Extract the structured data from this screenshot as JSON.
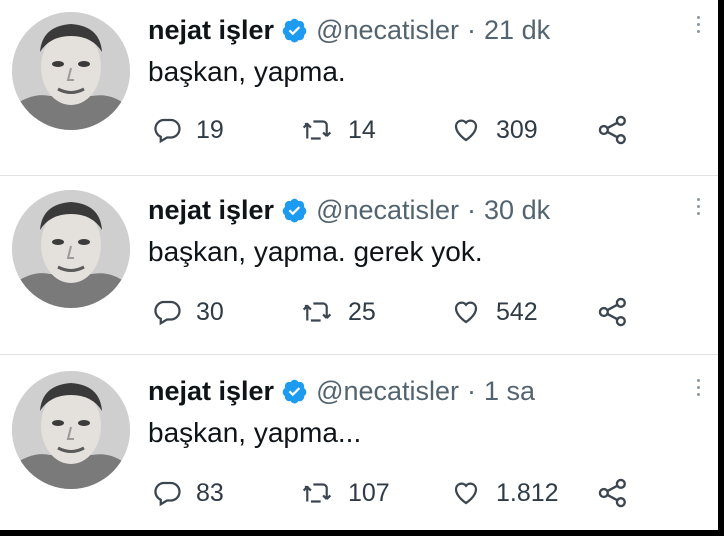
{
  "tweets": [
    {
      "author": "nejat işler",
      "handle": "@necatisler",
      "separator": "·",
      "time": "21 dk",
      "text": "başkan, yapma.",
      "replies": "19",
      "retweets": "14",
      "likes": "309"
    },
    {
      "author": "nejat işler",
      "handle": "@necatisler",
      "separator": "·",
      "time": "30 dk",
      "text": "başkan, yapma. gerek yok.",
      "replies": "30",
      "retweets": "25",
      "likes": "542"
    },
    {
      "author": "nejat işler",
      "handle": "@necatisler",
      "separator": "·",
      "time": "1 sa",
      "text": "başkan, yapma...",
      "replies": "83",
      "retweets": "107",
      "likes": "1.812"
    }
  ],
  "icons": {
    "reply": "reply-icon",
    "retweet": "retweet-icon",
    "like": "heart-icon",
    "share": "share-icon",
    "verified": "verified-badge-icon",
    "more": "more-options-icon"
  },
  "colors": {
    "verified": "#1d9bf0",
    "text": "#0f1419",
    "secondary": "#536471"
  }
}
